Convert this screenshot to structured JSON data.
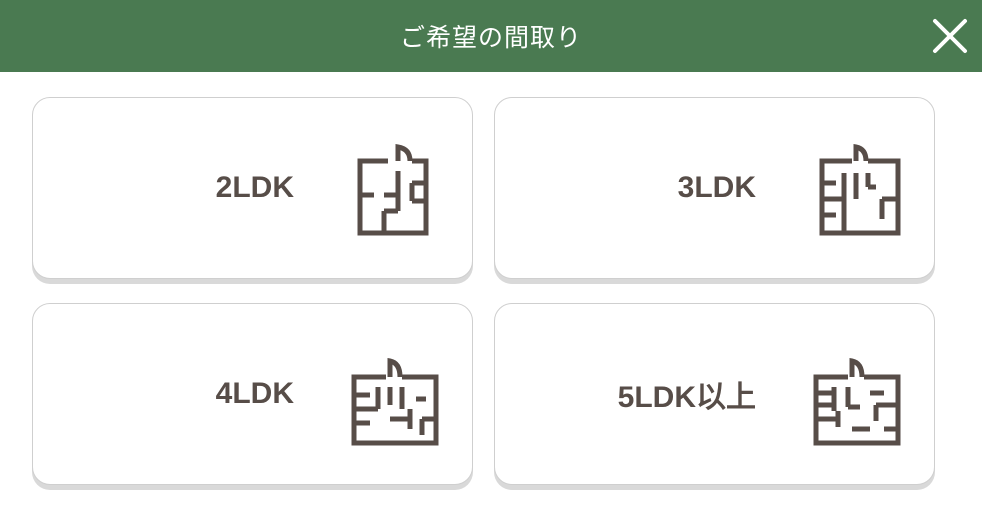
{
  "header": {
    "title": "ご希望の間取り",
    "close_icon": "close-icon",
    "background_color": "#4a7a51"
  },
  "options": [
    {
      "label": "2LDK",
      "icon": "floor-plan-icon"
    },
    {
      "label": "3LDK",
      "icon": "floor-plan-icon"
    },
    {
      "label": "4LDK",
      "icon": "floor-plan-icon"
    },
    {
      "label": "5LDK以上",
      "icon": "floor-plan-icon"
    }
  ],
  "colors": {
    "accent": "#4a7a51",
    "text": "#574d48",
    "card_border": "#cfcfcf"
  }
}
